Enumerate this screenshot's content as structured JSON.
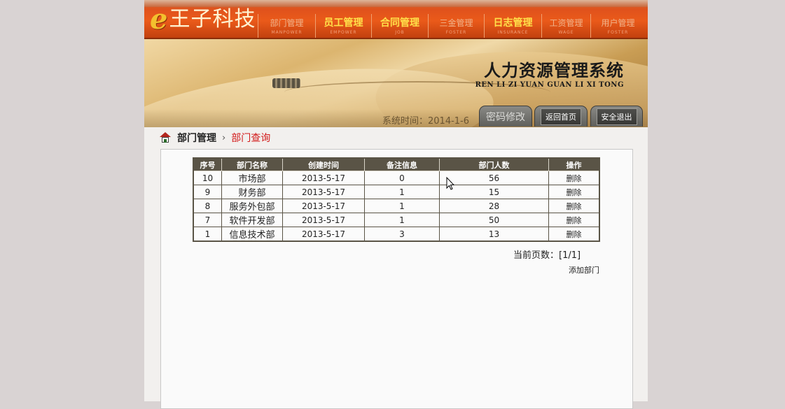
{
  "header": {
    "logo_letter": "e",
    "logo_text": "王子科技",
    "nav": [
      {
        "zh": "部门管理",
        "en": "MANPOWER",
        "state": "dim",
        "width": 82
      },
      {
        "zh": "员工管理",
        "en": "EMPOWER",
        "state": "active",
        "width": 80
      },
      {
        "zh": "合同管理",
        "en": "JOB",
        "state": "active",
        "width": 81
      },
      {
        "zh": "三金管理",
        "en": "FOSTER",
        "state": "dim",
        "width": 80
      },
      {
        "zh": "日志管理",
        "en": "INSURANCE",
        "state": "active",
        "width": 82
      },
      {
        "zh": "工资管理",
        "en": "WAGE",
        "state": "dim",
        "width": 70
      },
      {
        "zh": "用户管理",
        "en": "FOSTER",
        "state": "dim",
        "width": 78
      }
    ]
  },
  "banner": {
    "title_zh": "人力资源管理系统",
    "title_en": "REN LI ZI YUAN GUAN LI XI TONG",
    "system_time": "系统时间：2014-1-6",
    "buttons": {
      "password": "密码修改",
      "home": "返回首页",
      "exit": "安全退出"
    }
  },
  "breadcrumb": {
    "root": "部门管理",
    "separator": "›",
    "current": "部门查询"
  },
  "table": {
    "headers": [
      "序号",
      "部门名称",
      "创建时间",
      "备注信息",
      "部门人数",
      "操作"
    ],
    "rows": [
      {
        "id": "10",
        "name": "市场部",
        "created": "2013-5-17",
        "remark": "0",
        "count": "56",
        "action": "删除"
      },
      {
        "id": "9",
        "name": "财务部",
        "created": "2013-5-17",
        "remark": "1",
        "count": "15",
        "action": "删除"
      },
      {
        "id": "8",
        "name": "服务外包部",
        "created": "2013-5-17",
        "remark": "1",
        "count": "28",
        "action": "删除"
      },
      {
        "id": "7",
        "name": "软件开发部",
        "created": "2013-5-17",
        "remark": "1",
        "count": "50",
        "action": "删除"
      },
      {
        "id": "1",
        "name": "信息技术部",
        "created": "2013-5-17",
        "remark": "3",
        "count": "13",
        "action": "删除"
      }
    ]
  },
  "pager": "当前页数：[1/1]",
  "add_link": "添加部门",
  "colors": {
    "nav_bg": "#ea5a1a",
    "nav_active": "#ffe14a",
    "table_header": "#5a5446",
    "crumb_current": "#d21a1a"
  }
}
